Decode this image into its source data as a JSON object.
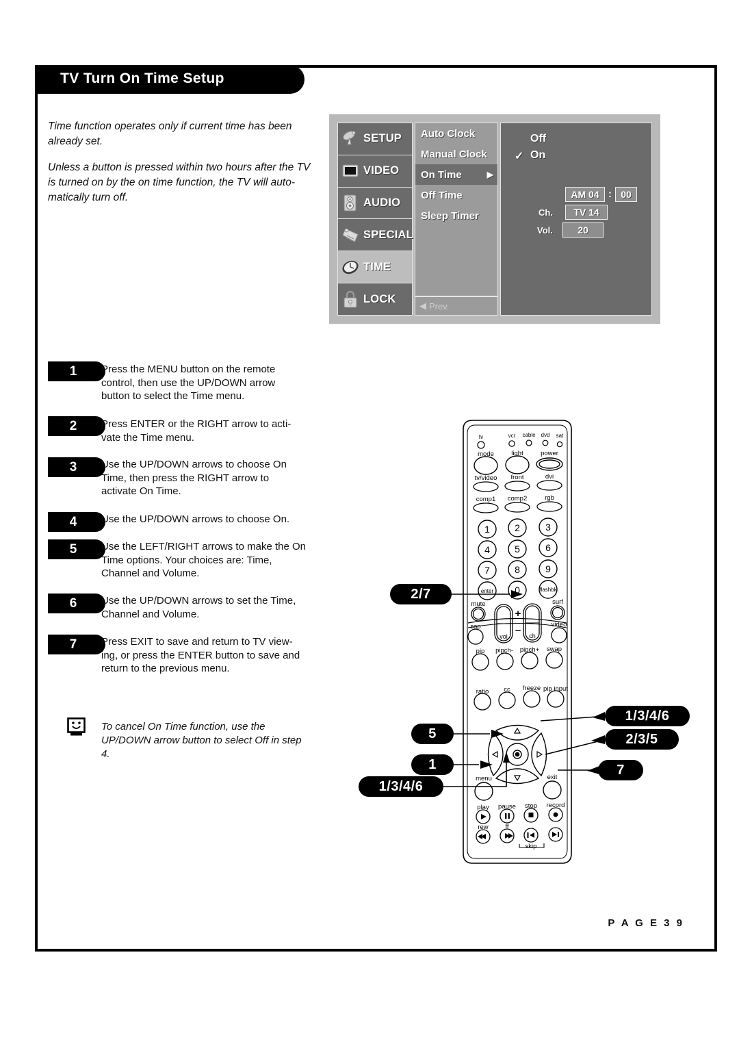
{
  "header": {
    "title": "TV Turn On Time Setup"
  },
  "intro": {
    "p1": "Time function operates only if current time has been already set.",
    "p2": "Unless a button is pressed within two hours after the TV is turned on by the on time function, the TV will auto-matically turn off."
  },
  "osd": {
    "categories": [
      {
        "label": "SETUP",
        "icon": "satellite-dish-icon",
        "selected": false
      },
      {
        "label": "VIDEO",
        "icon": "tv-screen-icon",
        "selected": false
      },
      {
        "label": "AUDIO",
        "icon": "speaker-icon",
        "selected": false
      },
      {
        "label": "SPECIAL",
        "icon": "tag-icon",
        "selected": false
      },
      {
        "label": "TIME",
        "icon": "clock-icon",
        "selected": true
      },
      {
        "label": "LOCK",
        "icon": "padlock-icon",
        "selected": false
      }
    ],
    "menu_items": [
      {
        "label": "Auto Clock",
        "highlighted": false,
        "arrow": ""
      },
      {
        "label": "Manual Clock",
        "highlighted": false,
        "arrow": ""
      },
      {
        "label": "On Time",
        "highlighted": true,
        "arrow": "▶"
      },
      {
        "label": "Off Time",
        "highlighted": false,
        "arrow": ""
      },
      {
        "label": "Sleep Timer",
        "highlighted": false,
        "arrow": ""
      }
    ],
    "prev_label": "Prev.",
    "prev_arrow": "◀",
    "options": {
      "off_label": "Off",
      "on_label": "On",
      "checkmark": "✓",
      "selected": "On"
    },
    "values": {
      "meridiem_hour": "AM 04",
      "colon": ":",
      "minute": "00",
      "ch_label": "Ch.",
      "ch_value": "TV 14",
      "vol_label": "Vol.",
      "vol_value": "20"
    }
  },
  "steps": [
    {
      "num": "1",
      "text": "Press the MENU button on the remote control, then use the UP/DOWN arrow button to select the Time menu."
    },
    {
      "num": "2",
      "text": "Press ENTER or the RIGHT arrow to acti-vate the Time menu."
    },
    {
      "num": "3",
      "text": "Use the UP/DOWN arrows to choose On Time, then press the RIGHT arrow to activate On Time."
    },
    {
      "num": "4",
      "text": "Use the UP/DOWN arrows to choose On."
    },
    {
      "num": "5",
      "text": "Use the LEFT/RIGHT arrows to make the On Time options. Your choices are: Time, Channel and Volume."
    },
    {
      "num": "6",
      "text": "Use the UP/DOWN arrows to set the Time, Channel and Volume."
    },
    {
      "num": "7",
      "text": "Press EXIT to save and return to TV view-ing, or press the ENTER button to save and return to the previous menu."
    }
  ],
  "note": {
    "icon": "smiley-tv-icon",
    "text": "To cancel On Time function, use the UP/DOWN arrow button to select Off in step 4."
  },
  "callouts": [
    {
      "id": "enter",
      "label": "2/7"
    },
    {
      "id": "up",
      "label": "1/3/4/6"
    },
    {
      "id": "right",
      "label": "2/3/5"
    },
    {
      "id": "left",
      "label": "5"
    },
    {
      "id": "menu",
      "label": "1"
    },
    {
      "id": "exit",
      "label": "7"
    },
    {
      "id": "down",
      "label": "1/3/4/6"
    }
  ],
  "remote": {
    "device_leds": [
      "tv",
      "vcr",
      "cable",
      "dvd",
      "sat"
    ],
    "row_mode": [
      "mode",
      "light",
      "power"
    ],
    "row_input1": [
      "tv/video",
      "front",
      "dvi"
    ],
    "row_input2": [
      "comp1",
      "comp2",
      "rgb"
    ],
    "keypad": [
      "1",
      "2",
      "3",
      "4",
      "5",
      "6",
      "7",
      "8",
      "9",
      "enter",
      "0",
      "flashbk"
    ],
    "row_mute": [
      "mute",
      "surf"
    ],
    "row_sap": [
      "sap",
      "video"
    ],
    "rockers": {
      "vol": "vol",
      "ch": "ch",
      "plus": "+",
      "minus": "–"
    },
    "row_pip": [
      "pip",
      "pipch-",
      "pipch+",
      "swap"
    ],
    "row_ratio": [
      "ratio",
      "cc",
      "freeze",
      "pip input"
    ],
    "nav": {
      "menu": "menu",
      "exit": "exit"
    },
    "row_transport": [
      "play",
      "pause",
      "stop",
      "record"
    ],
    "row_transport2": [
      "rew",
      "ff"
    ],
    "skip_label": "skip"
  },
  "footer": {
    "page": "P A G E   3 9"
  },
  "colors": {
    "osd_bg": "#b9b9b9",
    "osd_panel_dark": "#6b6b6b",
    "osd_panel_mid": "#9b9b9b",
    "highlight": "#bdbdbd",
    "black": "#000000"
  }
}
